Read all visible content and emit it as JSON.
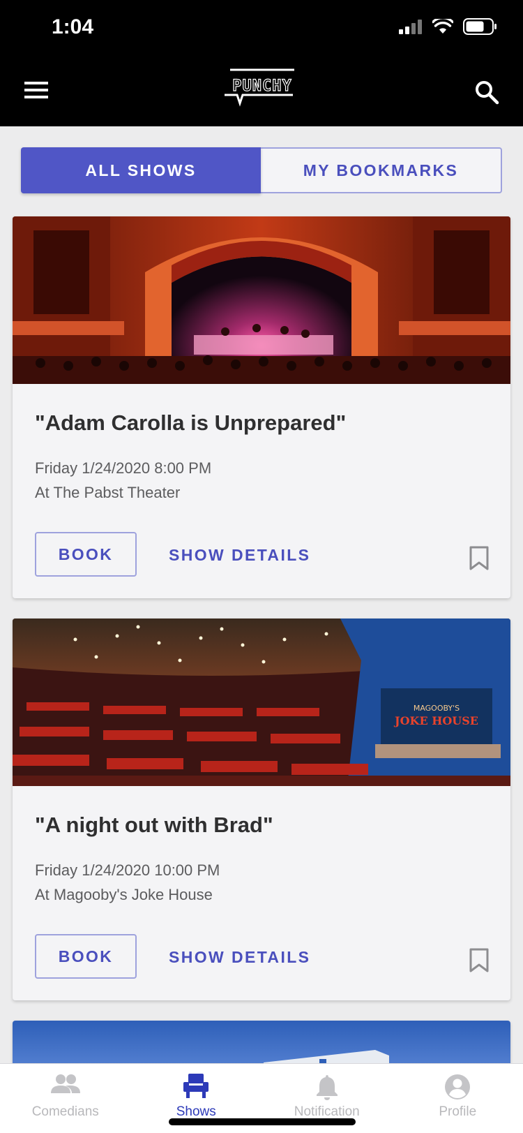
{
  "status_bar": {
    "time": "1:04"
  },
  "header": {
    "logo_text": "PUNCHY"
  },
  "segmented": {
    "all_shows": "ALL SHOWS",
    "my_bookmarks": "MY BOOKMARKS",
    "active": "all_shows"
  },
  "shows": [
    {
      "title": "\"Adam Carolla is Unprepared\"",
      "date": "Friday 1/24/2020 8:00 PM",
      "venue": "At The Pabst Theater",
      "book_label": "BOOK",
      "details_label": "SHOW DETAILS",
      "image": "theater-stage-photo"
    },
    {
      "title": "\"A night out with Brad\"",
      "date": "Friday 1/24/2020 10:00 PM",
      "venue": "At Magooby's Joke House",
      "book_label": "BOOK",
      "details_label": "SHOW DETAILS",
      "image": "comedy-club-photo",
      "image_sign": "MAGOOBY'S JOKE HOUSE"
    }
  ],
  "bottom_nav": {
    "items": [
      {
        "label": "Comedians",
        "icon": "people-icon"
      },
      {
        "label": "Shows",
        "icon": "seat-icon",
        "active": true
      },
      {
        "label": "Notification",
        "icon": "bell-icon"
      },
      {
        "label": "Profile",
        "icon": "profile-icon"
      }
    ]
  },
  "colors": {
    "accent": "#5056c6",
    "accent_text": "#4a4fbd",
    "header_bg": "#000000",
    "nav_active": "#2d3ab8"
  }
}
